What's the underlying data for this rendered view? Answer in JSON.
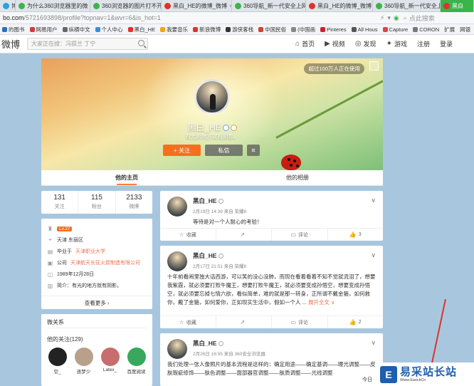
{
  "browser": {
    "tabs": [
      {
        "label": "博",
        "fav": "#2aa3e0",
        "w": 22
      },
      {
        "label": "为什么360浏览器里的微",
        "fav": "#3cb54a",
        "w": 105
      },
      {
        "label": "360浏览器的图片打不开",
        "fav": "#3cb54a",
        "w": 100
      },
      {
        "label": "黑白_HE的微博_微博",
        "fav": "#e0312a",
        "w": 99
      },
      {
        "label": "360导航_新一代安全上网",
        "fav": "#3cb54a",
        "w": 104
      },
      {
        "label": "黑白_HE的微博_微博",
        "fav": "#e0312a",
        "w": 94
      },
      {
        "label": "360导航_新一代安全上网",
        "fav": "#3cb54a",
        "w": 95
      },
      {
        "label": "黑白",
        "fav": "#e0312a",
        "w": 47
      }
    ],
    "url_domain": "bo.com",
    "url_path": "/5721693898/profile?topnav=1&wvr=6&is_hot=1",
    "search_placeholder": "点此搜索",
    "bookmarks": [
      "的图书",
      "网易用户",
      "纵横中文",
      "个人中心",
      "黑白_HE",
      "我要音乐",
      "新浪微博",
      "游侠客栈",
      "中国民俗",
      "(中国画",
      "Pinteres",
      "All Hous",
      "Capture",
      "CORON"
    ],
    "bookmarks_right": [
      "扩展",
      "网银",
      "翻"
    ]
  },
  "weibo_nav": {
    "logo": "微博",
    "search_placeholder": "大家正在搜：冯提兰 丁宁",
    "menu": [
      {
        "icon": "home-icon",
        "glyph": "⌂",
        "label": "首页"
      },
      {
        "icon": "video-icon",
        "glyph": "▶",
        "label": "视频"
      },
      {
        "icon": "discover-icon",
        "glyph": "◎",
        "label": "发现"
      },
      {
        "icon": "game-icon",
        "glyph": "✦",
        "label": "游戏"
      },
      {
        "icon": "",
        "glyph": "",
        "label": "注册"
      },
      {
        "icon": "",
        "glyph": "",
        "label": "登录"
      }
    ]
  },
  "profile": {
    "fans_badge": "超过100万人正在使用",
    "nickname": "黑白_HE",
    "bio": "有光的地方就有阴影。",
    "follow_label": "+ 关注",
    "message_label": "私信",
    "more_glyph": "≡",
    "tabs": [
      "他的主页",
      "他的相册"
    ]
  },
  "stats": [
    {
      "num": "131",
      "label": "关注"
    },
    {
      "num": "115",
      "label": "粉丝"
    },
    {
      "num": "2133",
      "label": "微博"
    }
  ],
  "info": {
    "level": "Lv.27",
    "location": "天津 东丽区",
    "school_prefix": "毕业于 ",
    "school": "天津职业大学",
    "company_prefix": "公司 ",
    "company": "天津航天长征火箭制造有限公司",
    "birthday": "1989年12月28日",
    "intro": "简介：有光的地方就有阴影。",
    "more": "查看更多 ›"
  },
  "relations": {
    "title": "微关系",
    "sub": "他的关注(129)",
    "people": [
      {
        "name": "空_",
        "color": "#222"
      },
      {
        "name": "逐梦少",
        "color": "#b9a08a"
      },
      {
        "name": "Latex_",
        "color": "#c86d6d"
      },
      {
        "name": "百度阅读",
        "color": "#37a85c"
      }
    ]
  },
  "posts": [
    {
      "name": "黑白_HE",
      "time": "2月19日 14:39 来自 荣耀8",
      "text": "等待是对一个人耐心的考验！",
      "expand": "",
      "actions": {
        "fav": "收藏",
        "share": "",
        "comment": "评论",
        "like": "3"
      }
    },
    {
      "name": "黑白_HE",
      "time": "2月17日 21:51 来自 荣耀8",
      "text": "十年前看闹里独大话西游，可以笑的没心没肺，而现在看着看着不知不觉就流泪了，想要我紫霞，就必须要打败牛魔王，想要打败牛魔王，就必须要变成孙悟空，想要变成孙悟空，就必须要忘掉七情六欲，看似简单，难的就是那一转身，正所谓不戴金箍，如何救你，戴了金箍，如何爱你，正如现实生活中，假如一个人 ...",
      "expand": "展开全文 ∨",
      "actions": {
        "fav": "收藏",
        "share": "",
        "comment": "评论",
        "like": "2"
      }
    },
    {
      "name": "黑白_HE",
      "time": "2月26日 16:55 来自 360安全浏览器",
      "text": "我们处理一张人像照片的基本流程是这样的：确定用途——确定基调——曝光调整——皮肤瑕疵修饰——肤色调整——面部器官调整——肤质调整——光线调整",
      "expand": "",
      "actions": {
        "fav": "",
        "share": "",
        "comment": "",
        "like": ""
      }
    }
  ],
  "watermark": {
    "logo": "E",
    "title": "易采站长站",
    "sub": "Www.EasckCn"
  },
  "status_text": "今日"
}
